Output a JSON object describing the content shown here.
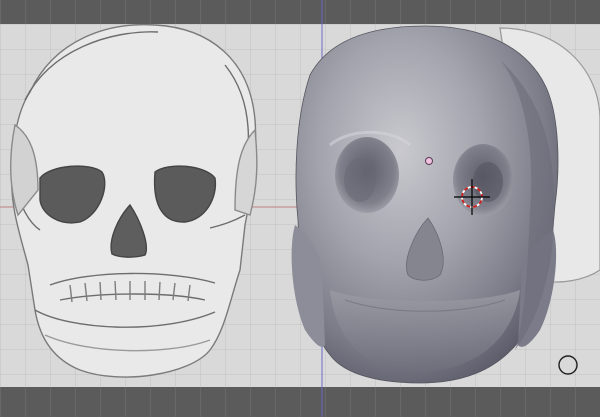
{
  "viewport": {
    "background_color": "#d9d9d9",
    "band_color": "#5b5b5b",
    "axis_x_color": "#c08080",
    "axis_y_color": "#6a6ac8"
  },
  "reference_image": {
    "subject": "skull-sketch"
  },
  "mesh": {
    "subject": "skull-sculpt",
    "shade_color": "#8e8e9a"
  },
  "cursor": {
    "icon": "3d-cursor-icon"
  },
  "object_origin": {
    "icon": "origin-dot-icon"
  },
  "brush_circle": {
    "icon": "brush-circle-icon"
  }
}
